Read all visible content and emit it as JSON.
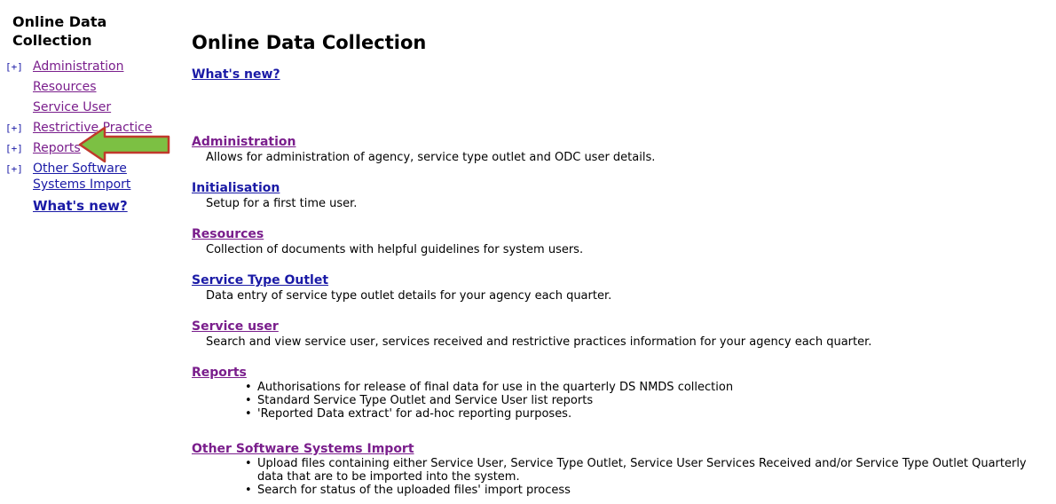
{
  "sidebar": {
    "title": "Online Data Collection",
    "expander": "[+]",
    "items": [
      {
        "label": "Administration",
        "expandable": true
      },
      {
        "label": "Resources",
        "expandable": false
      },
      {
        "label": "Service User",
        "expandable": false
      },
      {
        "label": "Restrictive  Practice",
        "expandable": true
      },
      {
        "label": "Reports",
        "expandable": true
      },
      {
        "label": "Other Software Systems Import",
        "expandable": true
      }
    ],
    "other_line1": "Other Software",
    "other_line2": "Systems Import",
    "whats_new": "What's new?"
  },
  "main": {
    "title": "Online Data Collection",
    "whats_new": "What's new?",
    "sections": [
      {
        "heading": "Administration",
        "desc": "Allows for administration of agency, service type outlet and ODC user details."
      },
      {
        "heading": "Initialisation",
        "desc": "Setup for a first time user."
      },
      {
        "heading": "Resources",
        "desc": "Collection of documents with helpful guidelines for system users."
      },
      {
        "heading": "Service Type Outlet",
        "desc": "Data entry of service type outlet details for your agency each quarter."
      },
      {
        "heading": "Service user",
        "desc": "Search and view service user, services received and restrictive practices information for your agency each quarter."
      },
      {
        "heading": "Reports",
        "bullets": [
          "Authorisations for release of final data for use in the quarterly DS NMDS collection",
          "Standard Service Type Outlet and Service User list reports",
          "'Reported Data extract' for ad-hoc reporting purposes."
        ]
      },
      {
        "heading": "Other Software Systems Import",
        "bullets": [
          "Upload files containing either Service User, Service Type Outlet, Service User Services Received and/or Service Type Outlet Quarterly data that are to be imported into the system.",
          "Search for status of the uploaded files' import process"
        ]
      }
    ]
  },
  "colors": {
    "link": "#1a1aa6",
    "visited": "#7a1e8c",
    "arrow_fill": "#7cc043",
    "arrow_stroke": "#c0392b"
  }
}
